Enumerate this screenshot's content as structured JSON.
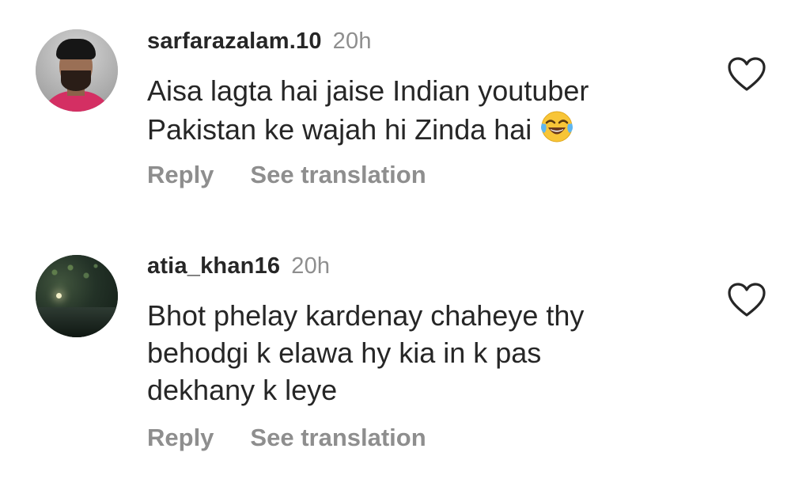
{
  "comments": [
    {
      "username": "sarfarazalam.10",
      "time": "20h",
      "text_lines": [
        "Aisa lagta hai jaise Indian youtuber",
        "Pakistan ke wajah hi Zinda hai"
      ],
      "emoji": "face-with-tears-of-joy",
      "reply_label": "Reply",
      "translate_label": "See translation",
      "avatar": "man-portrait"
    },
    {
      "username": "atia_khan16",
      "time": "20h",
      "text_lines": [
        "Bhot phelay kardenay chaheye thy",
        "behodgi k elawa hy kia in k pas",
        "dekhany k leye"
      ],
      "reply_label": "Reply",
      "translate_label": "See translation",
      "avatar": "night-lake"
    }
  ],
  "colors": {
    "text": "#262626",
    "secondary": "#8e8e8e",
    "background": "#ffffff"
  },
  "icons": {
    "like": "heart-outline-icon"
  }
}
